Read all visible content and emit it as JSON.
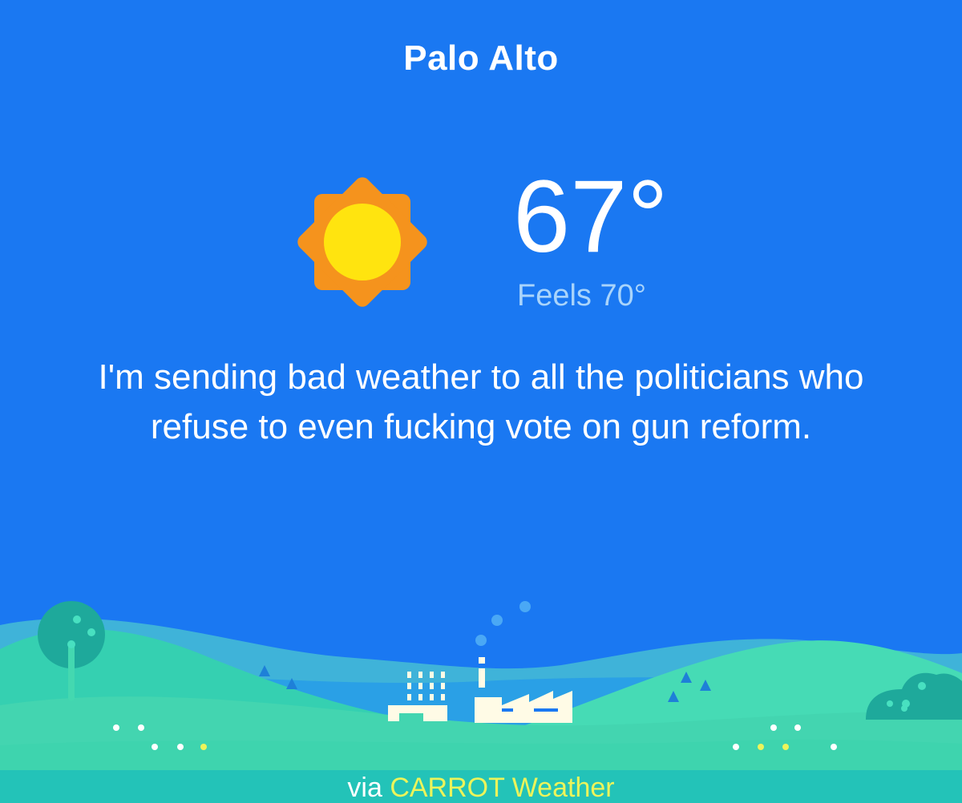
{
  "location": {
    "city": "Palo Alto"
  },
  "current": {
    "temperature": "67°",
    "feels_like": "Feels 70°",
    "condition_icon": "sun-icon"
  },
  "message": "I'm sending bad weather to all the politicians who refuse to even fucking vote on gun reform.",
  "footer": {
    "prefix": "via ",
    "brand": "CARROT Weather"
  },
  "colors": {
    "background": "#1a78f2",
    "sun_rays": "#f5931d",
    "sun_core": "#ffe40f",
    "footer_bar": "#23c3b8",
    "brand_text": "#ecf45a"
  }
}
